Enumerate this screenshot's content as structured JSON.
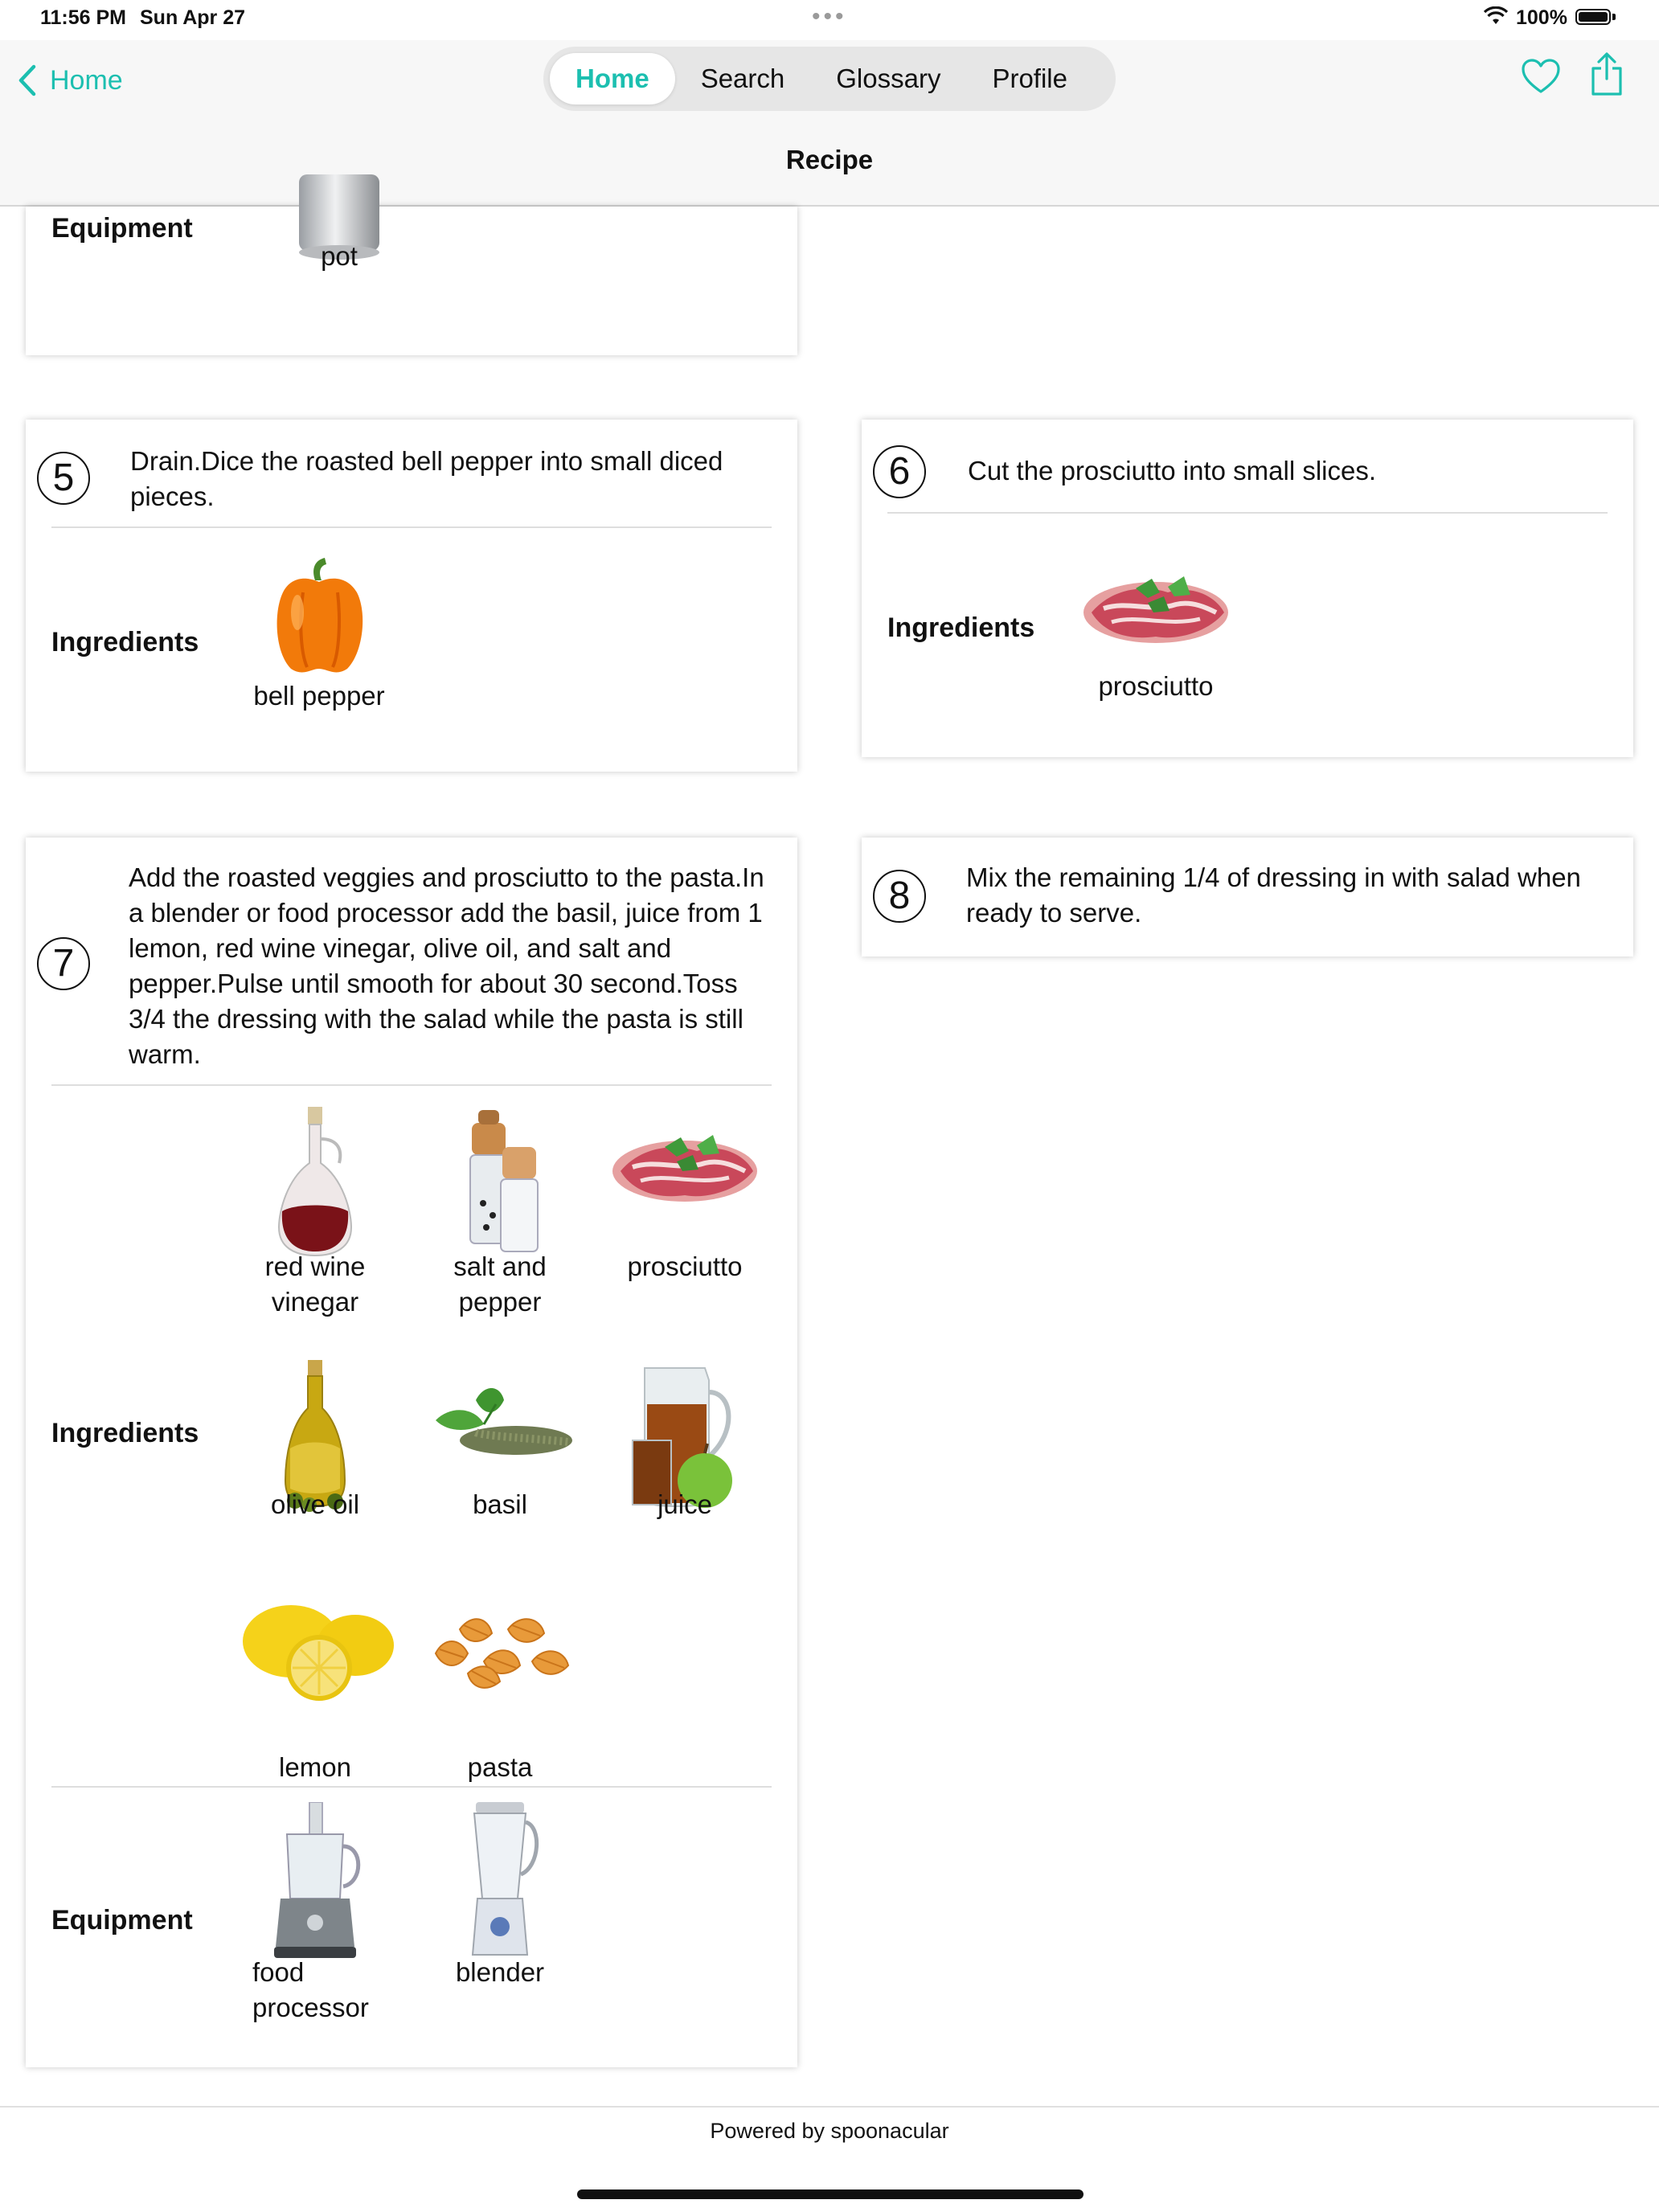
{
  "status_bar": {
    "time": "11:56 PM",
    "date": "Sun Apr 27",
    "battery": "100%"
  },
  "nav": {
    "back_label": "Home",
    "tabs": [
      {
        "label": "Home",
        "active": true
      },
      {
        "label": "Search",
        "active": false
      },
      {
        "label": "Glossary",
        "active": false
      },
      {
        "label": "Profile",
        "active": false
      }
    ],
    "title": "Recipe",
    "accent_color": "#1cbfb0"
  },
  "cards": {
    "partial_top": {
      "equipment_label": "Equipment",
      "equipment": [
        {
          "name": "pot",
          "icon": "pot-image"
        }
      ]
    },
    "step5": {
      "number": "5",
      "text": "Drain.Dice the roasted bell pepper into small diced pieces.",
      "ingredients_label": "Ingredients",
      "ingredients": [
        {
          "name": "bell pepper",
          "icon": "bell-pepper-image"
        }
      ]
    },
    "step6": {
      "number": "6",
      "text": "Cut the prosciutto into small slices.",
      "ingredients_label": "Ingredients",
      "ingredients": [
        {
          "name": "prosciutto",
          "icon": "prosciutto-image"
        }
      ]
    },
    "step7": {
      "number": "7",
      "text": "Add the roasted veggies and prosciutto to the pasta.In a blender or food processor add the basil, juice from 1 lemon, red wine vinegar, olive oil, and salt and pepper.Pulse until smooth for about 30 second.Toss 3/4 the dressing with the salad while the pasta is still warm.",
      "ingredients_label": "Ingredients",
      "ingredients": [
        {
          "name": "red wine vinegar",
          "icon": "red-wine-vinegar-image"
        },
        {
          "name": "salt and pepper",
          "icon": "salt-and-pepper-image"
        },
        {
          "name": "prosciutto",
          "icon": "prosciutto-image"
        },
        {
          "name": "olive oil",
          "icon": "olive-oil-image"
        },
        {
          "name": "basil",
          "icon": "basil-image"
        },
        {
          "name": "juice",
          "icon": "juice-image"
        },
        {
          "name": "lemon",
          "icon": "lemon-image"
        },
        {
          "name": "pasta",
          "icon": "pasta-image"
        }
      ],
      "equipment_label": "Equipment",
      "equipment": [
        {
          "name": "food processor",
          "icon": "food-processor-image"
        },
        {
          "name": "blender",
          "icon": "blender-image"
        }
      ]
    },
    "step8": {
      "number": "8",
      "text": "Mix the remaining 1/4 of dressing in with salad when ready to serve."
    }
  },
  "footer": "Powered by spoonacular"
}
